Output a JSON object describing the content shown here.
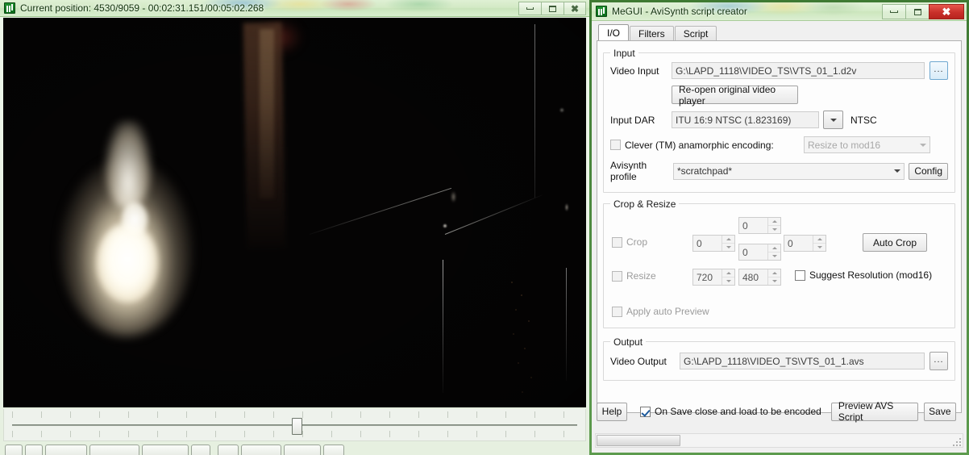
{
  "player_window": {
    "title": "Current position: 4530/9059   -   00:02:31.151/00:05:02.268",
    "icon": "megui-app-icon",
    "controls": {
      "minimize": "minimize-icon",
      "maximize": "maximize-icon",
      "close": "close-icon"
    },
    "timeline": {
      "position": 4530,
      "total": 9059,
      "thumb_percent": 50
    },
    "buttons": [
      "",
      "",
      "",
      "",
      "",
      "",
      "",
      "",
      ""
    ]
  },
  "megui_window": {
    "title": "MeGUI - AviSynth script creator",
    "icon": "megui-app-icon",
    "controls": {
      "minimize": "minimize-icon",
      "maximize": "maximize-icon",
      "close": "close-icon"
    },
    "tabs": [
      {
        "label": "I/O",
        "active": true
      },
      {
        "label": "Filters",
        "active": false
      },
      {
        "label": "Script",
        "active": false
      }
    ],
    "input": {
      "legend": "Input",
      "video_input_label": "Video Input",
      "video_input_value": "G:\\LAPD_1118\\VIDEO_TS\\VTS_01_1.d2v",
      "browse_label": "...",
      "reopen_button": "Re-open original video player",
      "dar_label": "Input DAR",
      "dar_value": "ITU 16:9 NTSC (1.823169)",
      "standard_label": "NTSC",
      "clever_label": "Clever (TM) anamorphic encoding:",
      "clever_checked": false,
      "clever_mode_value": "Resize to mod16",
      "profile_label": "Avisynth profile",
      "profile_value": "*scratchpad*",
      "config_button": "Config"
    },
    "crop_resize": {
      "legend": "Crop & Resize",
      "crop_label": "Crop",
      "crop_checked": false,
      "crop_left": "0",
      "crop_top": "0",
      "crop_bottom": "0",
      "crop_right": "0",
      "auto_crop_button": "Auto Crop",
      "resize_label": "Resize",
      "resize_checked": false,
      "resize_width": "720",
      "resize_height": "480",
      "suggest_label": "Suggest Resolution (mod16)",
      "suggest_checked": false,
      "apply_preview_label": "Apply auto Preview",
      "apply_preview_checked": false
    },
    "output": {
      "legend": "Output",
      "video_output_label": "Video Output",
      "video_output_value": "G:\\LAPD_1118\\VIDEO_TS\\VTS_01_1.avs",
      "browse_label": "..."
    },
    "footer": {
      "help_button": "Help",
      "on_save_label": "On Save close and load to be encoded",
      "on_save_checked": true,
      "preview_button": "Preview AVS Script",
      "save_button": "Save"
    }
  },
  "colors": {
    "aero_green": "#d4ebc7",
    "window_border_green": "#3f7a33",
    "close_red": "#c8302a",
    "tab_active": "#ffffff",
    "dialog_face": "#f0f0f0"
  }
}
